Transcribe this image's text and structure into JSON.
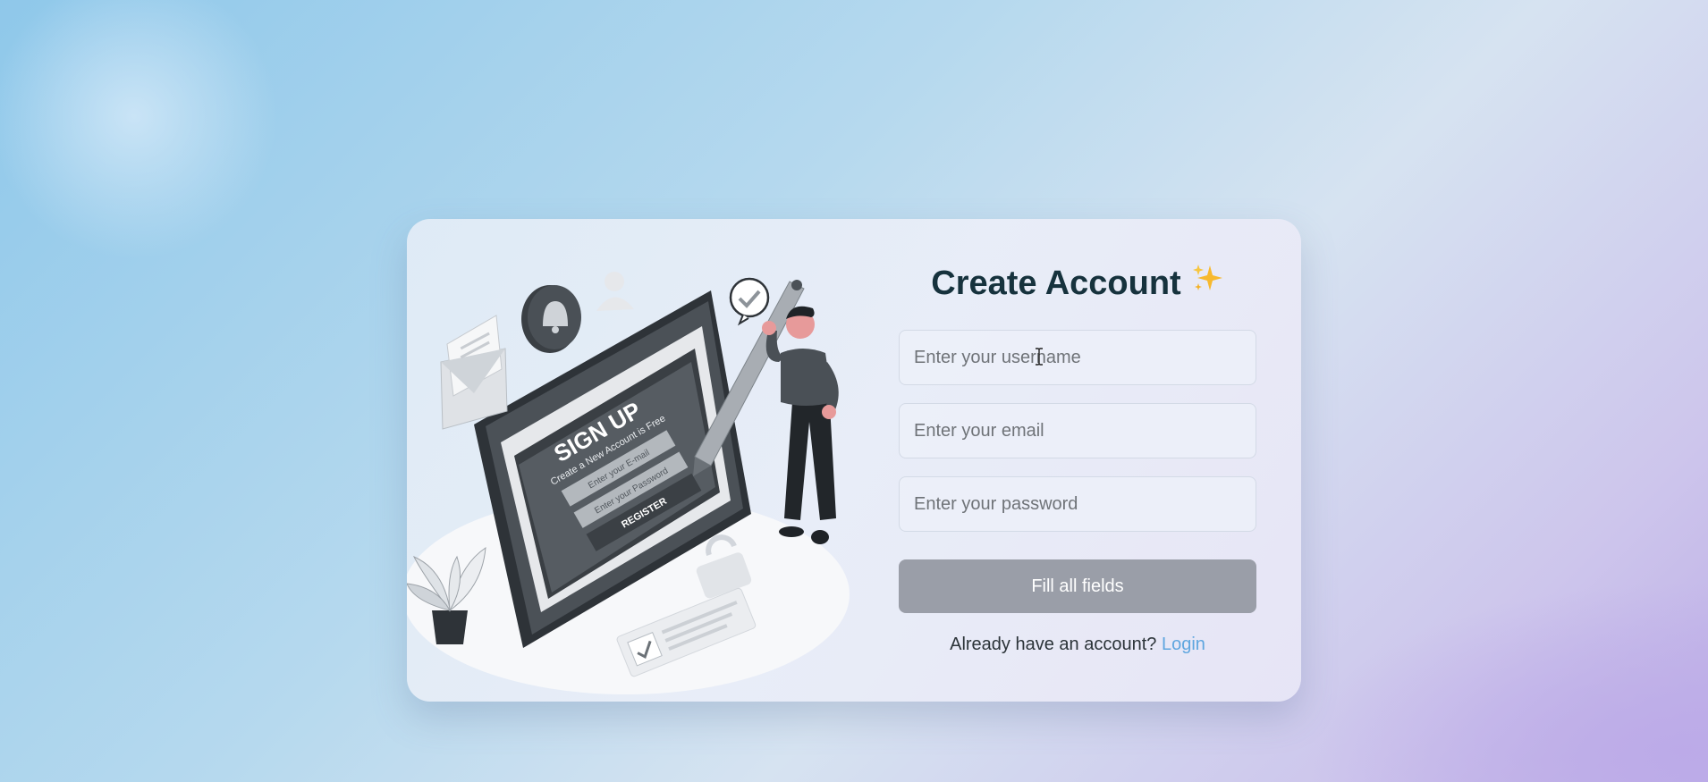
{
  "form": {
    "title": "Create Account",
    "title_icon": "sparkles-icon",
    "username_placeholder": "Enter your username",
    "email_placeholder": "Enter your email",
    "password_placeholder": "Enter your password",
    "submit_label": "Fill all fields",
    "login_prompt": "Already have an account?",
    "login_link": "Login"
  },
  "illustration": {
    "heading": "SIGN UP",
    "subheading": "Create a New Account is Free",
    "email_field": "Enter your E-mail",
    "password_field": "Enter your Password",
    "button": "REGISTER"
  },
  "colors": {
    "accent_link": "#5fa6df",
    "button_disabled": "#9a9ea8",
    "title": "#16323d"
  }
}
